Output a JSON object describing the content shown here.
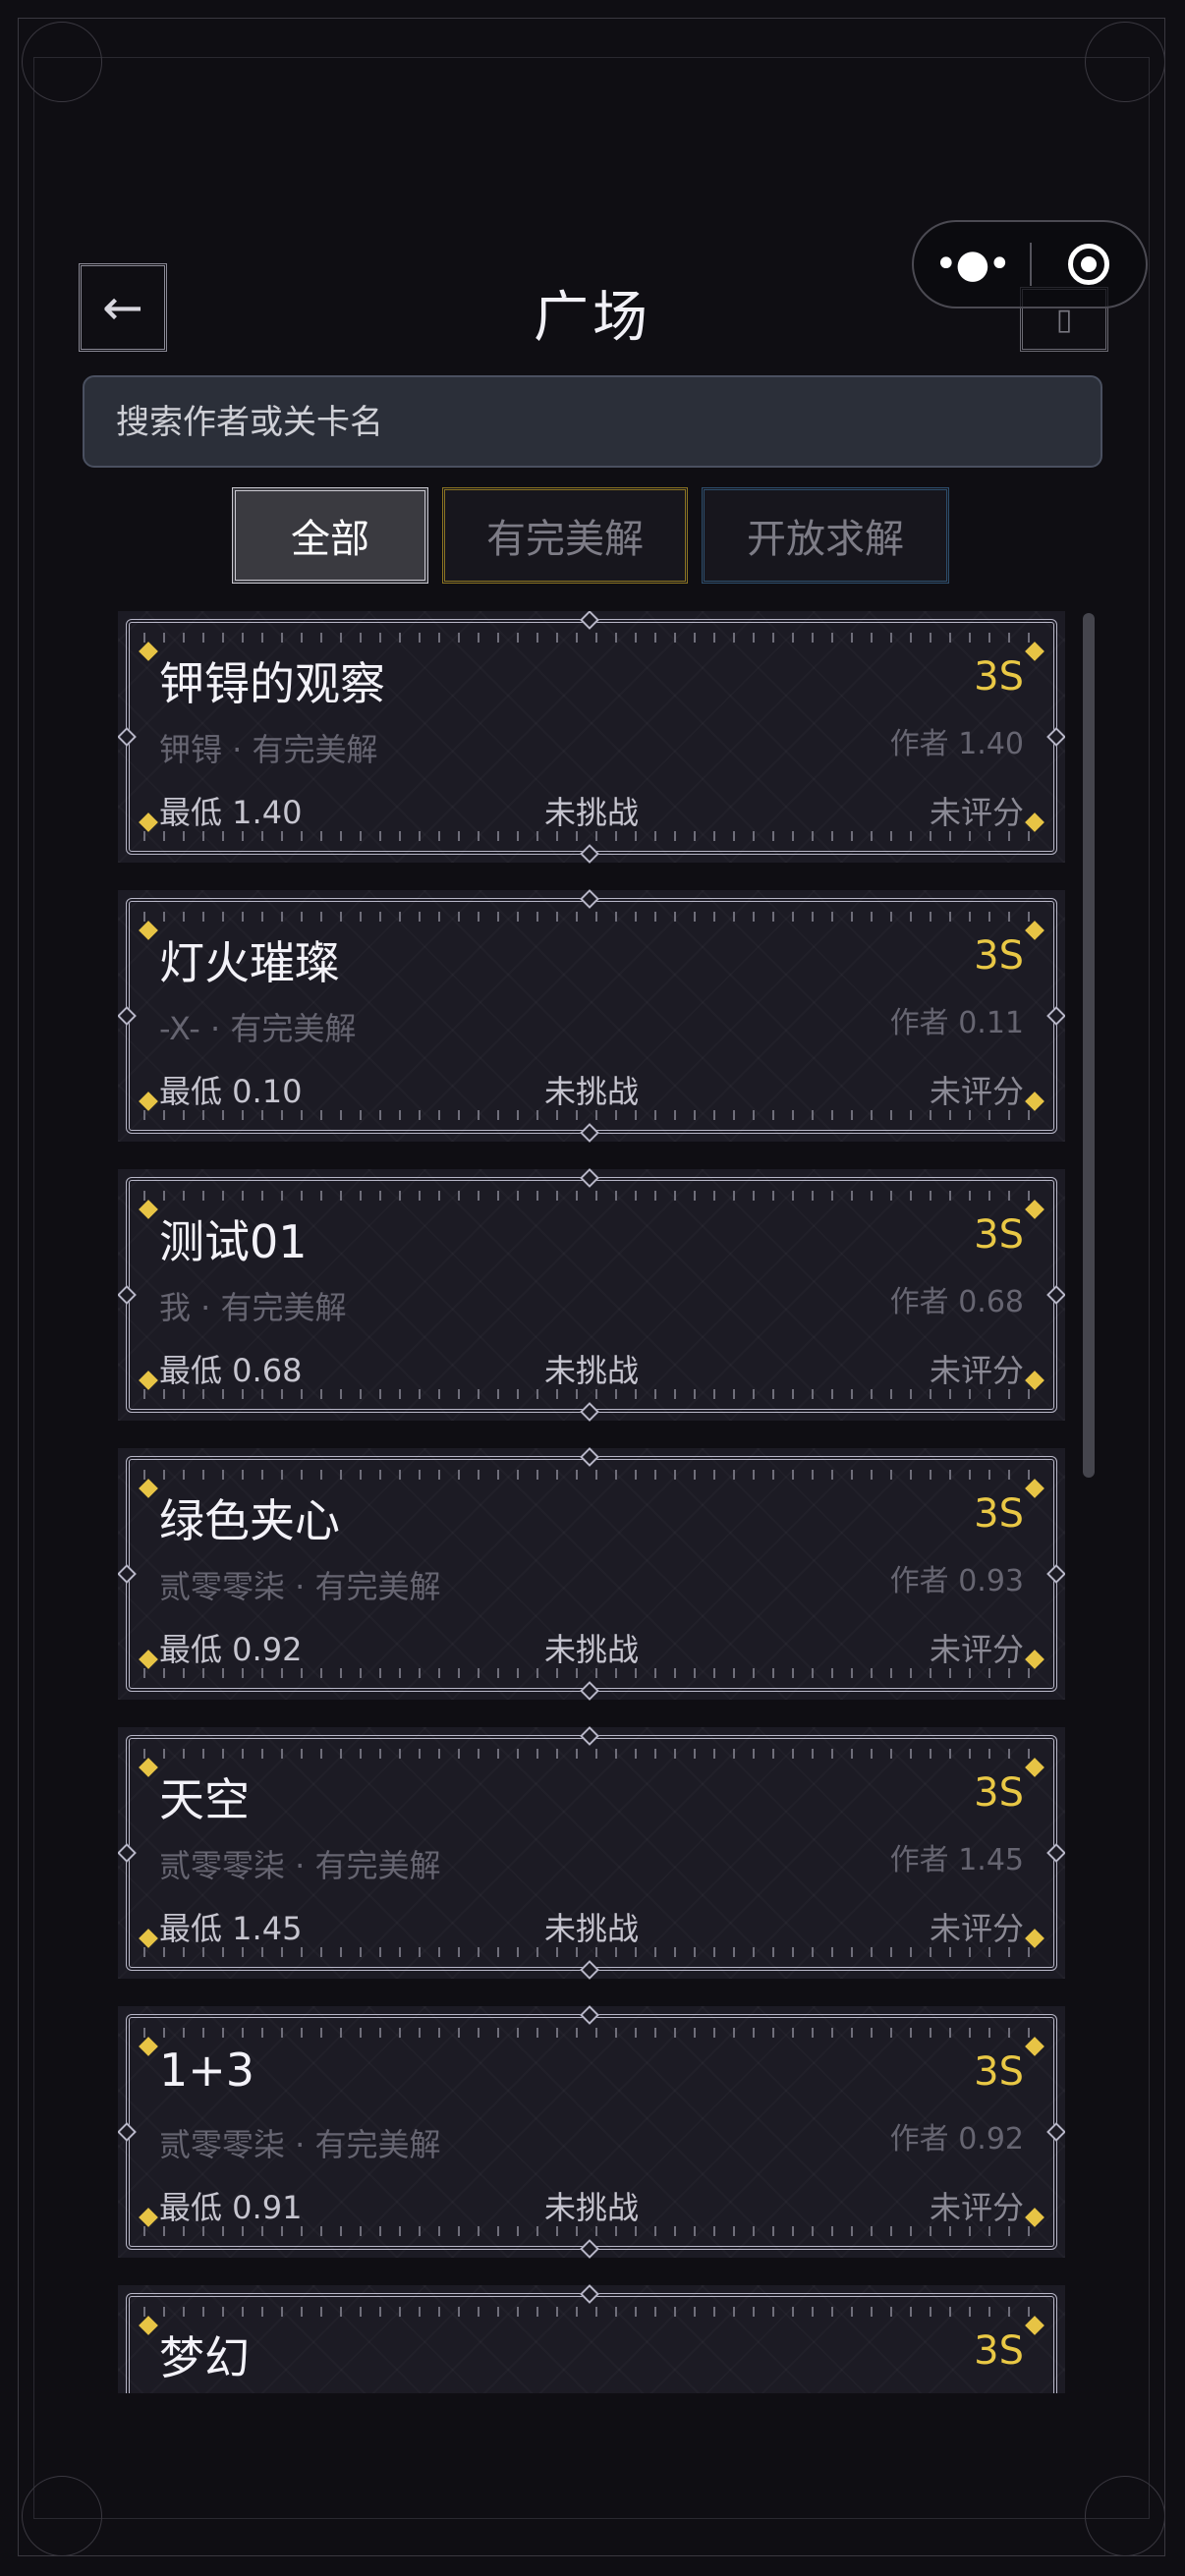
{
  "header": {
    "back_icon": "←",
    "title": "广场",
    "capsule_more": "•●•"
  },
  "search": {
    "placeholder": "搜索作者或关卡名",
    "value": ""
  },
  "tabs": [
    {
      "label": "全部",
      "active": true
    },
    {
      "label": "有完美解",
      "active": false
    },
    {
      "label": "开放求解",
      "active": false
    }
  ],
  "colors": {
    "accent_gold": "#e9c845",
    "background": "#0f0e13",
    "card": "#1c1b24"
  },
  "levels": [
    {
      "name": "钾锝的观察",
      "difficulty": "3S",
      "meta": "钾锝 · 有完美解",
      "author": "作者 1.40",
      "min": "最低 1.40",
      "status": "未挑战",
      "rating": "未评分"
    },
    {
      "name": "灯火璀璨",
      "difficulty": "3S",
      "meta": "-X- · 有完美解",
      "author": "作者 0.11",
      "min": "最低 0.10",
      "status": "未挑战",
      "rating": "未评分"
    },
    {
      "name": "测试01",
      "difficulty": "3S",
      "meta": "我 · 有完美解",
      "author": "作者 0.68",
      "min": "最低 0.68",
      "status": "未挑战",
      "rating": "未评分"
    },
    {
      "name": "绿色夹心",
      "difficulty": "3S",
      "meta": "贰零零柒 · 有完美解",
      "author": "作者 0.93",
      "min": "最低 0.92",
      "status": "未挑战",
      "rating": "未评分"
    },
    {
      "name": "天空",
      "difficulty": "3S",
      "meta": "贰零零柒 · 有完美解",
      "author": "作者 1.45",
      "min": "最低 1.45",
      "status": "未挑战",
      "rating": "未评分"
    },
    {
      "name": "1+3",
      "difficulty": "3S",
      "meta": "贰零零柒 · 有完美解",
      "author": "作者 0.92",
      "min": "最低 0.91",
      "status": "未挑战",
      "rating": "未评分"
    },
    {
      "name": "梦幻",
      "difficulty": "3S",
      "meta": "",
      "author": "",
      "min": "",
      "status": "",
      "rating": ""
    }
  ]
}
